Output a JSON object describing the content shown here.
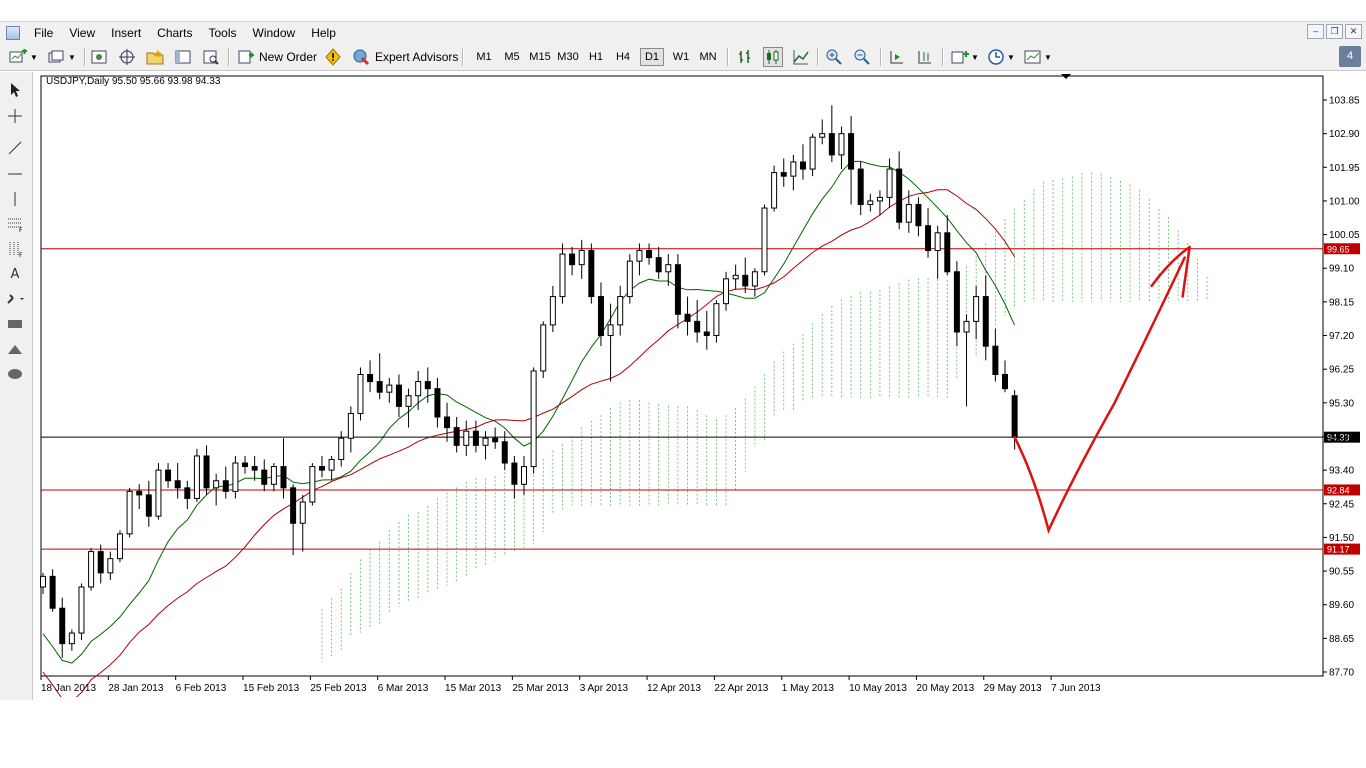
{
  "menu": [
    "File",
    "View",
    "Insert",
    "Charts",
    "Tools",
    "Window",
    "Help"
  ],
  "toolbar": {
    "new_order": "New Order",
    "expert_advisors": "Expert Advisors",
    "timeframes": [
      "M1",
      "M5",
      "M15",
      "M30",
      "H1",
      "H4",
      "D1",
      "W1",
      "MN"
    ],
    "active_timeframe": "D1"
  },
  "window_controls": [
    "minimize",
    "restore",
    "close"
  ],
  "tray_badge": "4",
  "chart": {
    "symbol_header": "USDJPY,Daily  95.50 95.66 93.98 94.33",
    "price_labels": [
      "103.85",
      "102.90",
      "101.95",
      "101.00",
      "100.05",
      "99.10",
      "98.15",
      "97.20",
      "96.25",
      "95.30",
      "94.35",
      "93.40",
      "92.45",
      "91.50",
      "90.55",
      "89.60",
      "88.65",
      "87.70"
    ],
    "date_labels": [
      "18 Jan 2013",
      "28 Jan 2013",
      "6 Feb 2013",
      "15 Feb 2013",
      "25 Feb 2013",
      "6 Mar 2013",
      "15 Mar 2013",
      "25 Mar 2013",
      "3 Apr 2013",
      "12 Apr 2013",
      "22 Apr 2013",
      "1 May 2013",
      "10 May 2013",
      "20 May 2013",
      "29 May 2013",
      "7 Jun 2013"
    ],
    "hlines": [
      {
        "label": "99.65",
        "price": 99.65,
        "color": "#c00000"
      },
      {
        "label": "94.33",
        "price": 94.33,
        "color": "#000000"
      },
      {
        "label": "92.84",
        "price": 92.84,
        "color": "#c00000"
      },
      {
        "label": "91.17",
        "price": 91.17,
        "color": "#c00000"
      }
    ],
    "colors": {
      "ma_fast": "#006400",
      "ma_slow": "#b00000",
      "cloud": "#5cb85c",
      "cloud_bear": "#d4875a",
      "drawing": "#dd1111"
    }
  },
  "chart_data": {
    "type": "candlestick",
    "symbol": "USDJPY",
    "timeframe": "Daily",
    "ylim": [
      87.7,
      103.85
    ],
    "last": {
      "open": 95.5,
      "high": 95.66,
      "low": 93.98,
      "close": 94.33
    },
    "ohlc": [
      [
        90.1,
        90.5,
        89.9,
        90.4
      ],
      [
        90.4,
        90.6,
        89.4,
        89.5
      ],
      [
        89.5,
        89.8,
        88.1,
        88.5
      ],
      [
        88.5,
        88.9,
        88.3,
        88.8
      ],
      [
        88.8,
        90.2,
        88.6,
        90.1
      ],
      [
        90.1,
        91.2,
        90.0,
        91.1
      ],
      [
        91.1,
        91.3,
        90.2,
        90.5
      ],
      [
        90.5,
        91.1,
        90.3,
        90.9
      ],
      [
        90.9,
        91.7,
        90.8,
        91.6
      ],
      [
        91.6,
        92.9,
        91.5,
        92.8
      ],
      [
        92.8,
        93.0,
        92.3,
        92.7
      ],
      [
        92.7,
        93.1,
        91.8,
        92.1
      ],
      [
        92.1,
        93.6,
        92.0,
        93.4
      ],
      [
        93.4,
        93.6,
        92.9,
        93.1
      ],
      [
        93.1,
        93.6,
        92.6,
        92.9
      ],
      [
        92.9,
        93.1,
        92.3,
        92.6
      ],
      [
        92.6,
        94.0,
        92.5,
        93.8
      ],
      [
        93.8,
        94.1,
        92.7,
        92.9
      ],
      [
        92.9,
        93.3,
        92.4,
        93.1
      ],
      [
        93.1,
        93.5,
        92.6,
        92.8
      ],
      [
        92.8,
        93.8,
        92.6,
        93.6
      ],
      [
        93.6,
        93.8,
        93.3,
        93.5
      ],
      [
        93.5,
        93.8,
        93.1,
        93.4
      ],
      [
        93.4,
        93.7,
        92.8,
        93.0
      ],
      [
        93.0,
        93.6,
        92.8,
        93.5
      ],
      [
        93.5,
        94.3,
        92.6,
        92.9
      ],
      [
        92.9,
        93.0,
        91.0,
        91.9
      ],
      [
        91.9,
        92.7,
        91.1,
        92.5
      ],
      [
        92.5,
        93.6,
        92.4,
        93.5
      ],
      [
        93.5,
        93.8,
        93.2,
        93.4
      ],
      [
        93.4,
        93.8,
        93.1,
        93.7
      ],
      [
        93.7,
        94.5,
        93.5,
        94.3
      ],
      [
        94.3,
        95.2,
        93.9,
        95.0
      ],
      [
        95.0,
        96.3,
        94.8,
        96.1
      ],
      [
        96.1,
        96.5,
        95.6,
        95.9
      ],
      [
        95.9,
        96.7,
        95.4,
        95.6
      ],
      [
        95.6,
        96.0,
        95.3,
        95.8
      ],
      [
        95.8,
        96.1,
        94.9,
        95.2
      ],
      [
        95.2,
        95.7,
        94.6,
        95.5
      ],
      [
        95.5,
        96.2,
        95.1,
        95.9
      ],
      [
        95.9,
        96.3,
        95.3,
        95.7
      ],
      [
        95.7,
        96.0,
        94.6,
        94.9
      ],
      [
        94.9,
        95.3,
        94.2,
        94.6
      ],
      [
        94.6,
        94.9,
        93.9,
        94.1
      ],
      [
        94.1,
        94.8,
        93.8,
        94.5
      ],
      [
        94.5,
        94.8,
        93.9,
        94.1
      ],
      [
        94.1,
        94.5,
        93.7,
        94.3
      ],
      [
        94.3,
        94.6,
        94.0,
        94.2
      ],
      [
        94.2,
        94.5,
        93.4,
        93.6
      ],
      [
        93.6,
        93.8,
        92.6,
        93.0
      ],
      [
        93.0,
        93.8,
        92.7,
        93.5
      ],
      [
        93.5,
        96.3,
        93.3,
        96.2
      ],
      [
        96.2,
        97.6,
        96.0,
        97.5
      ],
      [
        97.5,
        98.6,
        97.3,
        98.3
      ],
      [
        98.3,
        99.8,
        98.1,
        99.5
      ],
      [
        99.5,
        99.7,
        98.9,
        99.2
      ],
      [
        99.2,
        99.9,
        98.8,
        99.6
      ],
      [
        99.6,
        99.8,
        98.1,
        98.3
      ],
      [
        98.3,
        98.7,
        96.9,
        97.2
      ],
      [
        97.2,
        98.1,
        95.9,
        97.5
      ],
      [
        97.5,
        98.6,
        97.2,
        98.3
      ],
      [
        98.3,
        99.5,
        98.1,
        99.3
      ],
      [
        99.3,
        99.8,
        98.9,
        99.6
      ],
      [
        99.6,
        99.8,
        99.2,
        99.4
      ],
      [
        99.4,
        99.7,
        98.8,
        99.0
      ],
      [
        99.0,
        99.5,
        98.6,
        99.2
      ],
      [
        99.2,
        99.5,
        97.4,
        97.8
      ],
      [
        97.8,
        98.3,
        97.2,
        97.6
      ],
      [
        97.6,
        98.2,
        97.0,
        97.3
      ],
      [
        97.3,
        97.9,
        96.8,
        97.2
      ],
      [
        97.2,
        98.2,
        97.0,
        98.1
      ],
      [
        98.1,
        99.0,
        97.9,
        98.8
      ],
      [
        98.8,
        99.2,
        98.5,
        98.9
      ],
      [
        98.9,
        99.4,
        98.4,
        98.6
      ],
      [
        98.6,
        99.1,
        98.3,
        99.0
      ],
      [
        99.0,
        100.9,
        98.9,
        100.8
      ],
      [
        100.8,
        102.0,
        100.7,
        101.8
      ],
      [
        101.8,
        102.2,
        101.4,
        101.7
      ],
      [
        101.7,
        102.3,
        101.3,
        102.1
      ],
      [
        102.1,
        102.6,
        101.6,
        101.9
      ],
      [
        101.9,
        102.9,
        101.7,
        102.8
      ],
      [
        102.8,
        103.3,
        102.6,
        102.9
      ],
      [
        102.9,
        103.7,
        102.1,
        102.3
      ],
      [
        102.3,
        103.1,
        101.9,
        102.9
      ],
      [
        102.9,
        103.4,
        100.9,
        101.9
      ],
      [
        101.9,
        102.1,
        100.6,
        100.9
      ],
      [
        100.9,
        101.2,
        100.7,
        101.0
      ],
      [
        101.0,
        101.3,
        100.6,
        101.1
      ],
      [
        101.1,
        102.2,
        100.8,
        101.9
      ],
      [
        101.9,
        102.4,
        100.2,
        100.4
      ],
      [
        100.4,
        101.3,
        100.1,
        100.9
      ],
      [
        100.9,
        101.1,
        100.0,
        100.3
      ],
      [
        100.3,
        100.8,
        99.4,
        99.6
      ],
      [
        99.6,
        100.3,
        98.8,
        100.1
      ],
      [
        100.1,
        100.6,
        98.9,
        99.0
      ],
      [
        99.0,
        99.3,
        96.9,
        97.3
      ],
      [
        97.3,
        97.8,
        95.2,
        97.6
      ],
      [
        97.6,
        98.6,
        97.1,
        98.3
      ],
      [
        98.3,
        98.9,
        96.5,
        96.9
      ],
      [
        96.9,
        97.4,
        95.9,
        96.1
      ],
      [
        96.1,
        96.5,
        95.6,
        95.7
      ],
      [
        95.5,
        95.66,
        93.98,
        94.33
      ]
    ]
  }
}
